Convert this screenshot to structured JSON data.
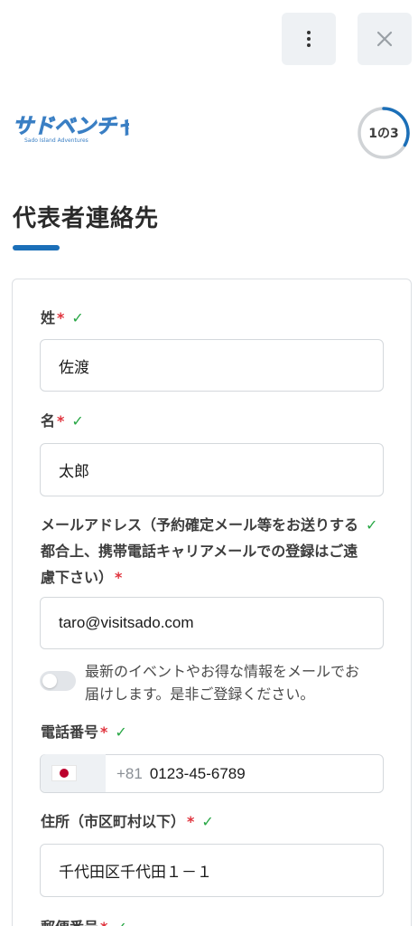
{
  "header": {
    "more_icon": "more-vertical-icon",
    "close_icon": "close-icon",
    "logo": {
      "main_text": "サドベンチャー!",
      "sub_text": "Sado Island Adventures",
      "color": "#3a7fc4"
    },
    "progress": {
      "label": "1の3",
      "current": 1,
      "total": 3,
      "color": "#1b6fb8"
    }
  },
  "page": {
    "title": "代表者連絡先",
    "accent_color": "#1b6fb8"
  },
  "form": {
    "last_name": {
      "label": "姓",
      "required": "*",
      "check": "✓",
      "value": "佐渡"
    },
    "first_name": {
      "label": "名",
      "required": "*",
      "check": "✓",
      "value": "太郎"
    },
    "email": {
      "label_line1": "メールアドレス（予約確定メール等をお送りする",
      "label_line2": "都合上、携帯電話キャリアメールでの登録はご遠",
      "label_line3": "慮下さい）",
      "required": "*",
      "check": "✓",
      "value": "taro@visitsado.com"
    },
    "newsletter": {
      "line1": "最新のイベントやお得な情報をメールでお",
      "line2": "届けします。是非ご登録ください。",
      "enabled": false
    },
    "phone": {
      "label": "電話番号",
      "required": "*",
      "check": "✓",
      "country_code": "+81",
      "value": "0123-45-6789",
      "flag": "japan-flag"
    },
    "address": {
      "label": "住所（市区町村以下）",
      "required": "*",
      "check": "✓",
      "value": "千代田区千代田１－１"
    },
    "postal": {
      "label": "郵便番号",
      "required": "*",
      "check": "✓"
    }
  },
  "colors": {
    "required": "#e0333d",
    "check": "#28a745"
  }
}
